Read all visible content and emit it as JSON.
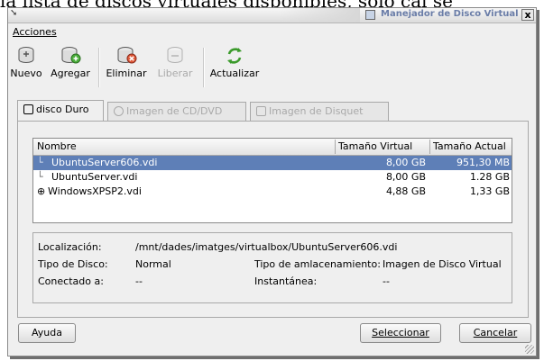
{
  "background_caption": "la lista de discos virtuales disponibles, sólo cal se",
  "window": {
    "title": "Manejador de Disco Virtual",
    "close_glyph": "x"
  },
  "menu": {
    "acciones_label": "Acciones"
  },
  "toolbar": {
    "items": [
      {
        "label": "Nuevo",
        "icon": "new-disk-icon",
        "enabled": true
      },
      {
        "label": "Agregar",
        "icon": "add-disk-icon",
        "enabled": true
      },
      {
        "label": "Eliminar",
        "icon": "remove-disk-icon",
        "enabled": true
      },
      {
        "label": "Liberar",
        "icon": "release-disk-icon",
        "enabled": false
      },
      {
        "label": "Actualizar",
        "icon": "refresh-icon",
        "enabled": true
      }
    ]
  },
  "tabs": [
    {
      "label": "disco Duro",
      "active": true
    },
    {
      "label": "Imagen de CD/DVD",
      "active": false
    },
    {
      "label": "Imagen de Disquet",
      "active": false
    }
  ],
  "list": {
    "columns": [
      "Nombre",
      "Tamaño Virtual",
      "Tamaño Actual"
    ],
    "rows": [
      {
        "name": "UbuntuServer606.vdi",
        "virtual": "8,00 GB",
        "actual": "951,30 MB",
        "selected": true,
        "expander": ""
      },
      {
        "name": "UbuntuServer.vdi",
        "virtual": "8,00 GB",
        "actual": "1.28 GB",
        "selected": false,
        "expander": ""
      },
      {
        "name": "WindowsXPSP2.vdi",
        "virtual": "4,88 GB",
        "actual": "1,33 GB",
        "selected": false,
        "expander": "⊕"
      }
    ]
  },
  "details": {
    "location_label": "Localización:",
    "location_value": "/mnt/dades/imatges/virtualbox/UbuntuServer606.vdi",
    "disk_type_label": "Tipo de Disco:",
    "disk_type_value": "Normal",
    "storage_type_label": "Tipo de amlacenamiento:",
    "storage_type_value": "Imagen de Disco Virtual",
    "connected_label": "Conectado a:",
    "connected_value": "--",
    "snapshot_label": "Instantánea:",
    "snapshot_value": "--"
  },
  "buttons": {
    "help": "Ayuda",
    "select": "Seleccionar",
    "cancel": "Cancelar"
  },
  "colors": {
    "selection": "#5e7fb7",
    "title_text": "#6a7da8",
    "refresh_green": "#3a9a2a"
  }
}
